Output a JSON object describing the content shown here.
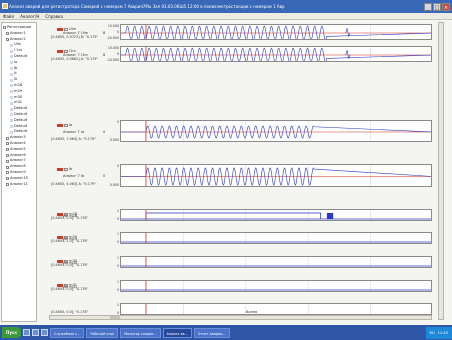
{
  "window": {
    "title": "Анализ аварий для регистратора Самарий с номером 7 Авария7Mu Зап 03.03.06Ш5 12:00 в полиэлектростанции с номером 1 Авр",
    "minimize": "_",
    "maximize": "□",
    "close": "×"
  },
  "menu": [
    "Файл",
    "Аналог/Н",
    "Справка"
  ],
  "tree": [
    {
      "label": "Регистрация",
      "level": 0,
      "toggle": true
    },
    {
      "label": "Аналог1",
      "level": 1,
      "toggle": true
    },
    {
      "label": "Аналог2",
      "level": 1,
      "toggle": true
    },
    {
      "label": "Ulm",
      "level": 2,
      "toggle": false
    },
    {
      "label": "I 1m",
      "level": 2,
      "toggle": false
    },
    {
      "label": "Default",
      "level": 2,
      "toggle": false
    },
    {
      "label": "Ia",
      "level": 2,
      "toggle": false
    },
    {
      "label": "Ib",
      "level": 2,
      "toggle": false
    },
    {
      "label": "Ic",
      "level": 2,
      "toggle": false
    },
    {
      "label": "I0",
      "level": 2,
      "toggle": false
    },
    {
      "label": "m28",
      "level": 2,
      "toggle": false
    },
    {
      "label": "m29",
      "level": 2,
      "toggle": false
    },
    {
      "label": "m30",
      "level": 2,
      "toggle": false
    },
    {
      "label": "m31",
      "level": 2,
      "toggle": false
    },
    {
      "label": "Default",
      "level": 2,
      "toggle": false
    },
    {
      "label": "Default",
      "level": 2,
      "toggle": false
    },
    {
      "label": "Default",
      "level": 2,
      "toggle": false
    },
    {
      "label": "Default",
      "level": 2,
      "toggle": false
    },
    {
      "label": "Default",
      "level": 2,
      "toggle": false
    },
    {
      "label": "Аналог3",
      "level": 1,
      "toggle": true
    },
    {
      "label": "Аналог4",
      "level": 1,
      "toggle": true
    },
    {
      "label": "Аналог5",
      "level": 1,
      "toggle": true
    },
    {
      "label": "Аналог6",
      "level": 1,
      "toggle": true
    },
    {
      "label": "Аналог7",
      "level": 1,
      "toggle": true
    },
    {
      "label": "Аналог8",
      "level": 1,
      "toggle": true
    },
    {
      "label": "Аналог9",
      "level": 1,
      "toggle": true
    },
    {
      "label": "Аналог10",
      "level": 1,
      "toggle": true
    },
    {
      "label": "Аналог11",
      "level": 1,
      "toggle": true
    }
  ],
  "channels": [
    {
      "badge": "Ulm",
      "name": "Аналог 7 Ulm",
      "value": "8",
      "info": "[0.4655, 0.0723] В; \"0.179\"",
      "yticks": [
        "10.000",
        "0",
        "-10.000"
      ],
      "kind": "analog",
      "amp": 0.85,
      "start": 0.015,
      "stop": 0.66,
      "blip": 0.72
    },
    {
      "badge": "I1m",
      "name": "Аналог 7 I1m",
      "value": "8",
      "info": "[0.4655, 0.0662] А; \"0.179\"",
      "yticks": [
        "10.000",
        "0",
        "-10.000"
      ],
      "kind": "analog",
      "amp": 0.85,
      "start": 0.015,
      "stop": 0.66,
      "blip": 0.72
    },
    {
      "badge": "Ia",
      "name": "Аналог 7 Ia",
      "value": "0",
      "info": "[0.4655, 7.064] А; \"0.179\"",
      "yticks": [
        "0",
        "0.000"
      ],
      "kind": "analog",
      "amp": 0.55,
      "start": 0.08,
      "stop": 0.62,
      "blip": 0
    },
    {
      "badge": "Ib",
      "name": "Аналог 7 Ib",
      "value": "0",
      "info": "[0.4655, 4.063] А; \"0.179\"",
      "yticks": [
        "0",
        "0.000"
      ],
      "kind": "analog",
      "amp": 0.75,
      "start": 0.08,
      "stop": 0.62,
      "blip": 0
    },
    {
      "badge": "m28",
      "name": "Д1 m28",
      "value": "",
      "info": "[0.4655, 0.0]; \"0.178\"",
      "yticks": [
        "1",
        "0"
      ],
      "kind": "digital",
      "on": [
        0.08,
        0.64
      ],
      "tail": [
        0.66,
        0.68
      ]
    },
    {
      "badge": "m29",
      "name": "Д1 m29",
      "value": "",
      "info": "[0.4655, 1.0]; \"0.178\"",
      "yticks": [
        "1",
        "0"
      ],
      "kind": "digital",
      "on": [
        0.0,
        0.0
      ]
    },
    {
      "badge": "m30",
      "name": "Д1 m30",
      "value": "",
      "info": "[0.4655, 0.0]; \"0.178\"",
      "yticks": [
        "1",
        "0"
      ],
      "kind": "digital",
      "on": [
        0.0,
        0.0
      ]
    },
    {
      "badge": "m31",
      "name": "Д1 m31",
      "value": "",
      "info": "[0.4655, 0.0]; \"0.178\"",
      "yticks": [
        "1",
        "0"
      ],
      "kind": "digital",
      "on": [
        0.0,
        0.0
      ]
    },
    {
      "badge": "",
      "name": "",
      "value": "",
      "info": "[0.4655, 0.0]; \"0.178\"",
      "yticks": [
        "1",
        "0"
      ],
      "kind": "empty"
    }
  ],
  "xaxis": {
    "ticks": [
      "0",
      "1",
      "2",
      "3",
      "4",
      "5"
    ],
    "label": "Время"
  },
  "colors": {
    "signal": "#2a3ac0",
    "marker": "#d8281e",
    "grid": "#c8c8c8",
    "plot_bg": "#ffffff"
  },
  "taskbar": {
    "start": "Пуск",
    "tasks": [
      "Служебная с...",
      "Рабочий стол",
      "Монитор сохран...",
      "Анализ ав...",
      "Отчет Аварии..."
    ],
    "active_task": 3,
    "tray": [
      "RU",
      "11:45"
    ]
  }
}
